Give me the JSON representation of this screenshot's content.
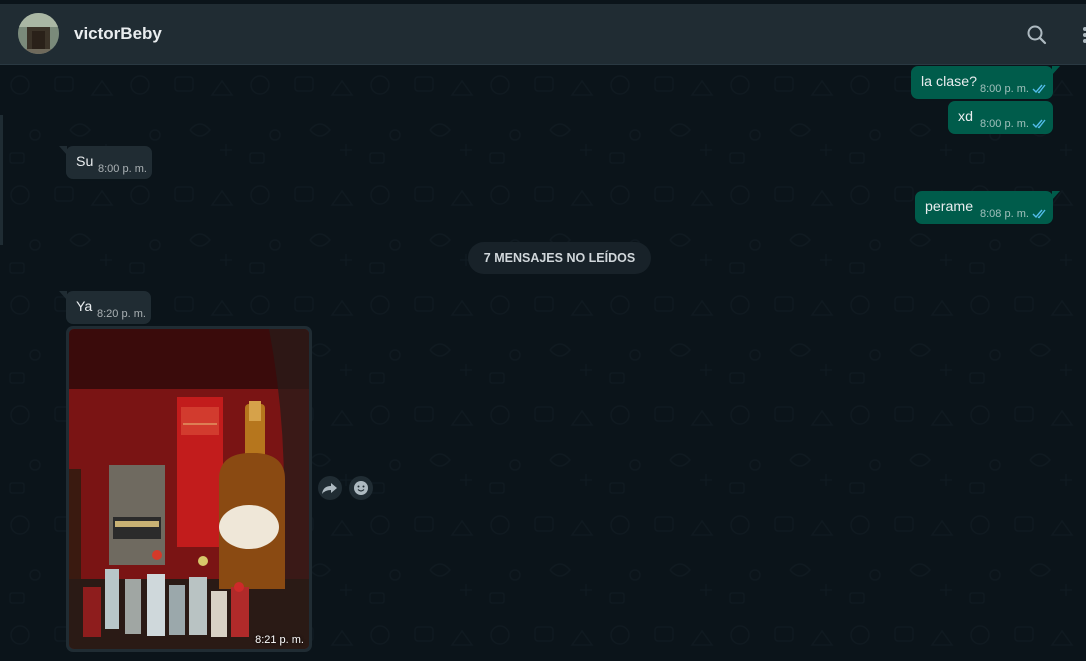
{
  "contact": {
    "name": "victorBeby"
  },
  "header": {
    "icons": [
      "search-icon",
      "menu-icon"
    ]
  },
  "messages": [
    {
      "direction": "outgoing",
      "text": "la clase?",
      "time": "8:00 p. m.",
      "status": "read"
    },
    {
      "direction": "outgoing",
      "text": "xd",
      "time": "8:00 p. m.",
      "status": "read"
    },
    {
      "direction": "incoming",
      "text": "Su",
      "time": "8:00 p. m."
    },
    {
      "direction": "outgoing",
      "text": "perame",
      "time": "8:08 p. m.",
      "status": "read"
    },
    {
      "direction": "incoming",
      "text": "Ya",
      "time": "8:20 p. m."
    },
    {
      "direction": "incoming",
      "type": "image",
      "time": "8:21 p. m.",
      "image_description_icon": "photo-icon"
    }
  ],
  "unread_divider": "7 MENSAJES NO LEÍDOS",
  "message_actions": [
    "forward-icon",
    "emoji-icon"
  ],
  "colors": {
    "background": "#0b141a",
    "header": "#202c33",
    "outgoing_bubble": "#005c4b",
    "incoming_bubble": "#202c33",
    "read_ticks": "#53bdeb"
  }
}
